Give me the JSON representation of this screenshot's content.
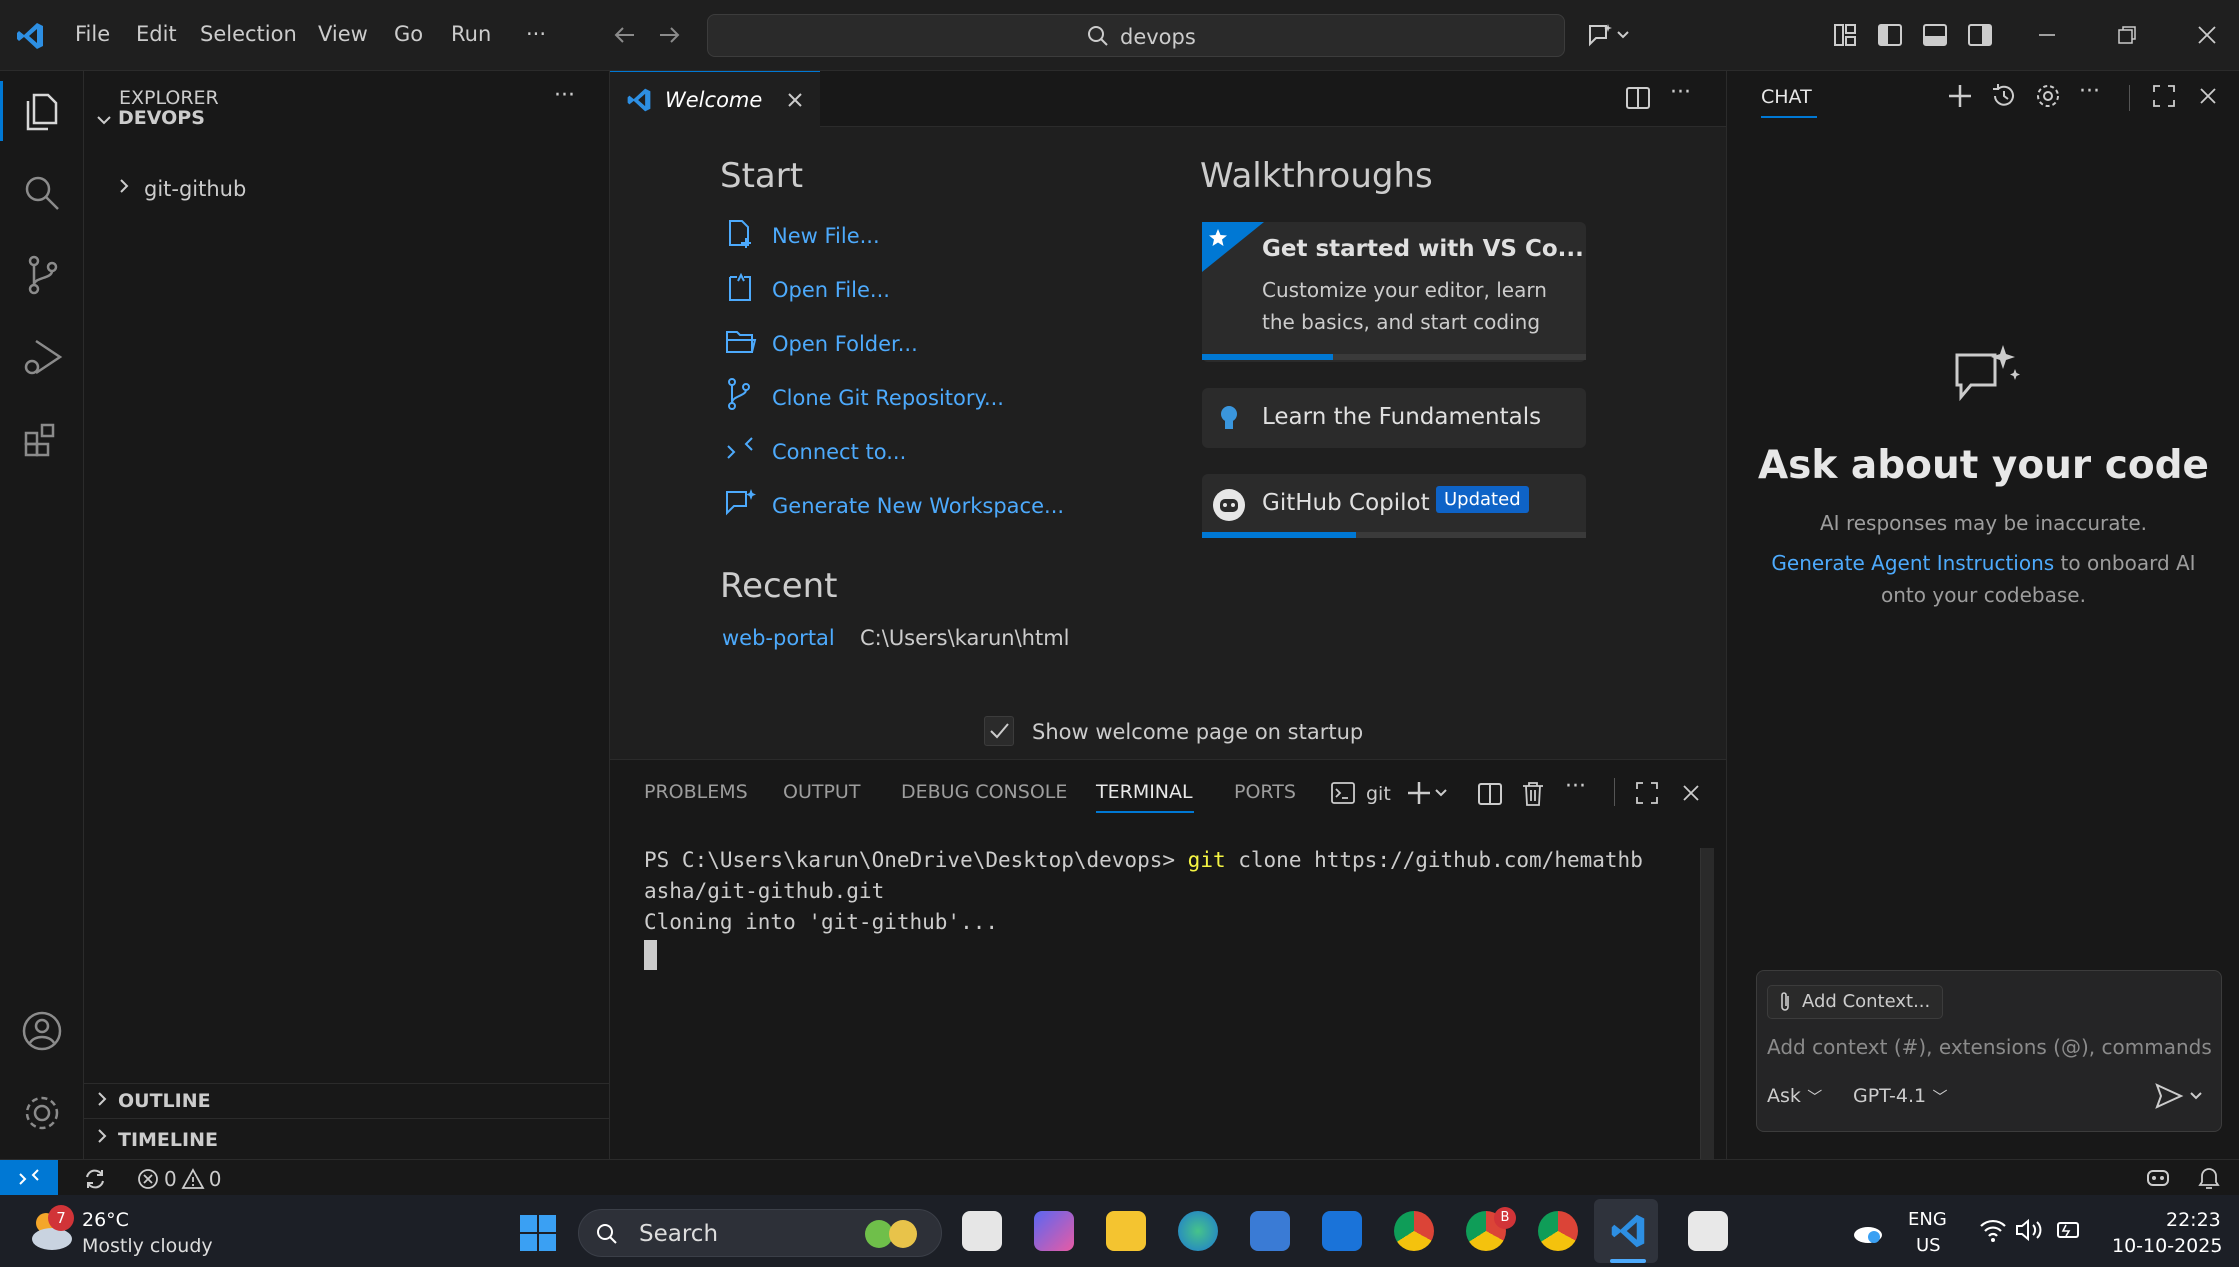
{
  "titlebar": {
    "menu": [
      "File",
      "Edit",
      "Selection",
      "View",
      "Go",
      "Run",
      "···"
    ],
    "search_text": "devops"
  },
  "explorer": {
    "header": "EXPLORER",
    "more": "···",
    "root_folder": "DEVOPS",
    "items": [
      "git-github"
    ],
    "outline": "OUTLINE",
    "timeline": "TIMELINE"
  },
  "editor": {
    "tab_label": "Welcome",
    "start": {
      "heading": "Start",
      "items": [
        "New File...",
        "Open File...",
        "Open Folder...",
        "Clone Git Repository...",
        "Connect to...",
        "Generate New Workspace..."
      ]
    },
    "recent": {
      "heading": "Recent",
      "items": [
        {
          "name": "web-portal",
          "path": "C:\\Users\\karun\\html"
        }
      ]
    },
    "walkthroughs": {
      "heading": "Walkthroughs",
      "featured_title": "Get started with VS Co...",
      "featured_desc_line1": "Customize your editor, learn",
      "featured_desc_line2": "the basics, and start coding",
      "featured_progress": 0.34,
      "fundamentals": "Learn the Fundamentals",
      "copilot": "GitHub Copilot",
      "copilot_badge": "Updated",
      "copilot_progress": 0.4
    },
    "show_on_startup": "Show welcome page on startup"
  },
  "panel": {
    "tabs": [
      "PROBLEMS",
      "OUTPUT",
      "DEBUG CONSOLE",
      "TERMINAL",
      "PORTS"
    ],
    "active_tab": "TERMINAL",
    "terminal_name": "git",
    "prompt": "PS C:\\Users\\karun\\OneDrive\\Desktop\\devops>",
    "command_keyword": "git",
    "command_rest": " clone https://github.com/hemathb",
    "line2": "asha/git-github.git",
    "line3": "Cloning into 'git-github'..."
  },
  "chat": {
    "header": "CHAT",
    "title": "Ask about your code",
    "disclaimer": "AI responses may be inaccurate.",
    "link": "Generate Agent Instructions",
    "link_suffix": " to onboard AI",
    "line2": "onto your codebase.",
    "add_context": "Add Context...",
    "placeholder": "Add context (#), extensions (@), commands",
    "mode": "Ask",
    "model": "GPT-4.1"
  },
  "statusbar": {
    "errors": "0",
    "warnings": "0"
  },
  "taskbar": {
    "temp": "26°C",
    "weather": "Mostly cloudy",
    "weather_badge": "7",
    "search": "Search",
    "lang": "ENG",
    "region": "US",
    "time": "22:23",
    "date": "10-10-2025",
    "chrome_badge": "B"
  },
  "colors": {
    "accent": "#0078d4",
    "link": "#4daafc",
    "badge_blue": "#0e63c7"
  }
}
